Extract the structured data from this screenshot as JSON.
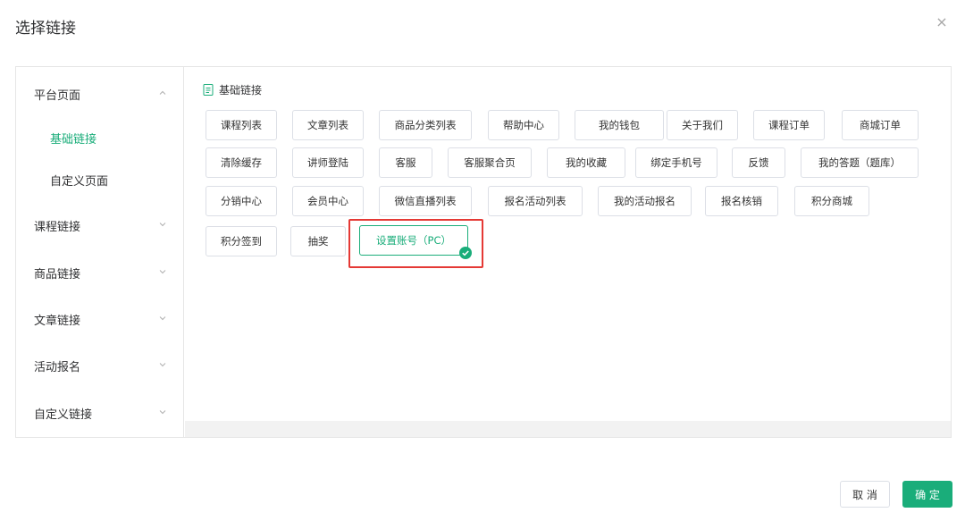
{
  "dialog": {
    "title": "选择链接",
    "close_glyph": "×"
  },
  "sidebar": {
    "groups": [
      {
        "label": "平台页面",
        "expanded": true,
        "children": [
          {
            "label": "基础链接",
            "active": true
          },
          {
            "label": "自定义页面",
            "active": false
          }
        ]
      },
      {
        "label": "课程链接",
        "expanded": false
      },
      {
        "label": "商品链接",
        "expanded": false
      },
      {
        "label": "文章链接",
        "expanded": false
      },
      {
        "label": "活动报名",
        "expanded": false
      },
      {
        "label": "自定义链接",
        "expanded": false
      }
    ]
  },
  "content": {
    "section_title": "基础链接",
    "links": [
      "课程列表",
      "文章列表",
      "商品分类列表",
      "帮助中心",
      "我的钱包",
      "关于我们",
      "课程订单",
      "商城订单",
      "清除缓存",
      "讲师登陆",
      "客服",
      "客服聚合页",
      "我的收藏",
      "绑定手机号",
      "反馈",
      "我的答题（题库）",
      "分销中心",
      "会员中心",
      "微信直播列表",
      "报名活动列表",
      "我的活动报名",
      "报名核销",
      "积分商城",
      "积分签到",
      "抽奖",
      "设置账号（PC）"
    ],
    "selected_link": "设置账号（PC）"
  },
  "footer": {
    "cancel_label": "取 消",
    "confirm_label": "确 定"
  },
  "colors": {
    "accent": "#1aad7a",
    "highlight": "#e53935",
    "border": "#dcdfe6"
  }
}
